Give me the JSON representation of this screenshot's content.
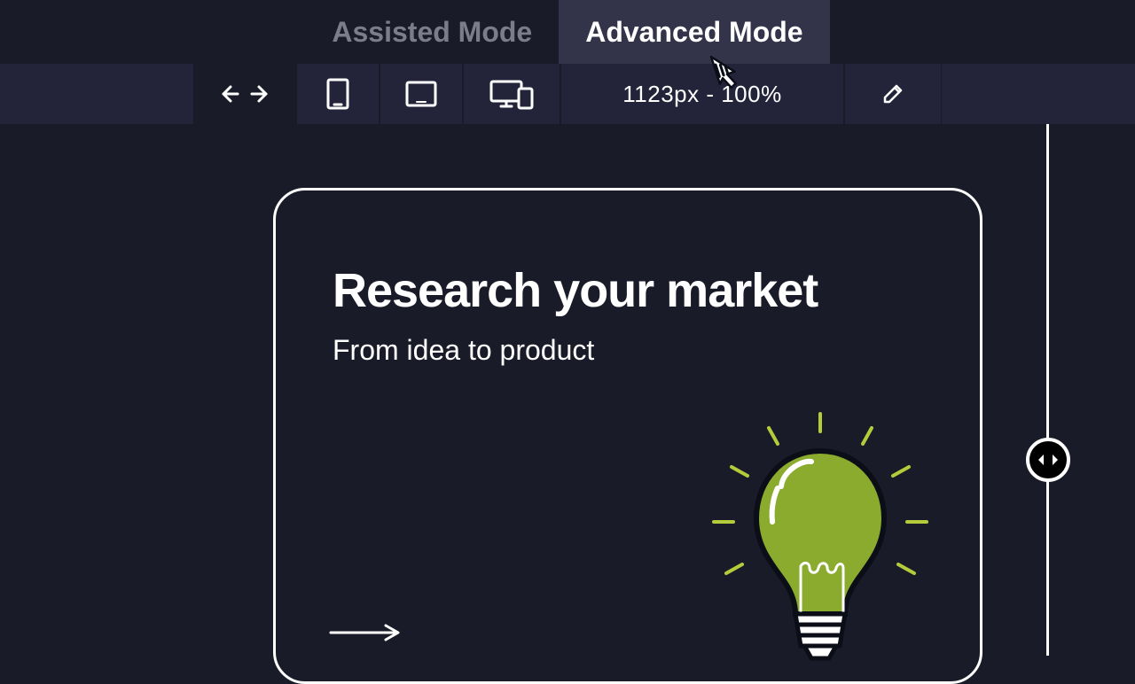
{
  "modeTabs": {
    "assisted": "Assisted Mode",
    "advanced": "Advanced Mode"
  },
  "deviceToolbar": {
    "sizeLabel": "1123px - 100%"
  },
  "card": {
    "title": "Research your market",
    "subtitle": "From idea to product"
  }
}
